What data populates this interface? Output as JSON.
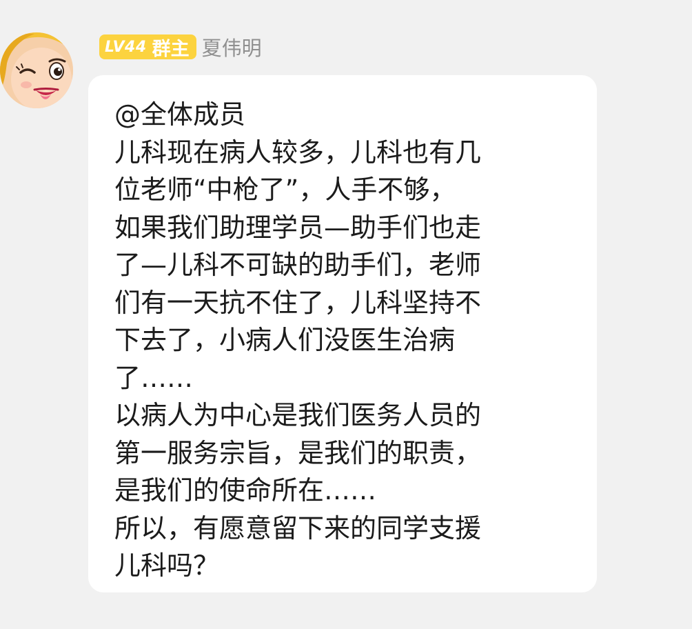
{
  "sender": {
    "level_badge": "LV44",
    "role_badge": "群主",
    "name": "夏伟明",
    "avatar_icon": "cartoon-winking-face-avatar"
  },
  "message": {
    "lines": [
      "@全体成员",
      "儿科现在病人较多，儿科也有几",
      "位老师“中枪了”，人手不够，",
      "如果我们助理学员—助手们也走",
      "了—儿科不可缺的助手们，老师",
      "们有一天抗不住了，儿科坚持不",
      "下去了，小病人们没医生治病",
      "了……",
      "以病人为中心是我们医务人员的",
      "第一服务宗旨，是我们的职责，",
      "是我们的使命所在……",
      "所以，有愿意留下来的同学支援",
      "儿科吗？"
    ]
  },
  "colors": {
    "background": "#f1f1f1",
    "bubble": "#ffffff",
    "badge": "#fcd33f",
    "name_text": "#8f8f8f",
    "message_text": "#1b1b1b"
  }
}
